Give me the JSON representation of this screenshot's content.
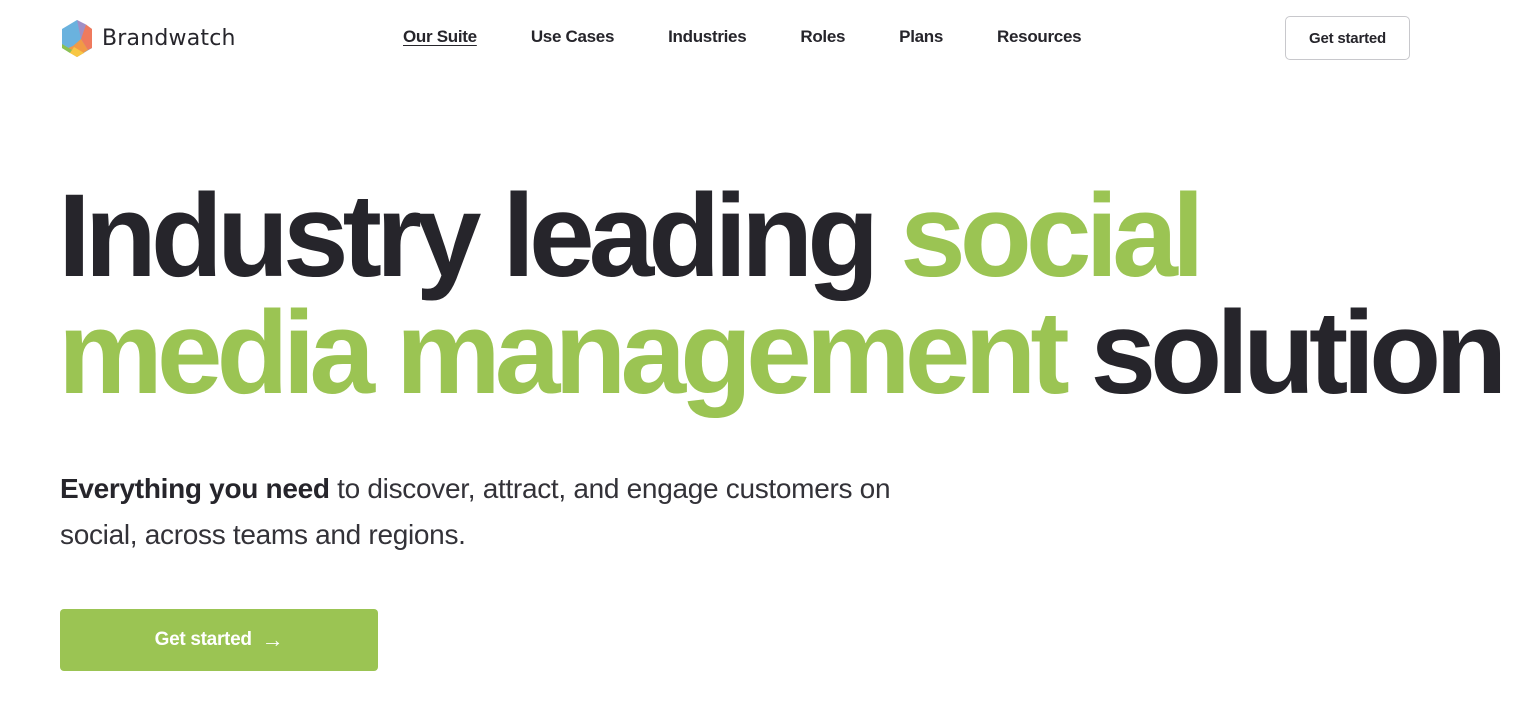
{
  "brand": {
    "name": "Brandwatch",
    "logo_colors": [
      "#6ab2de",
      "#a08fc6",
      "#ef7a5e",
      "#f29a45",
      "#f8c744",
      "#8cc152"
    ]
  },
  "nav": {
    "items": [
      {
        "label": "Our Suite",
        "active": true
      },
      {
        "label": "Use Cases",
        "active": false
      },
      {
        "label": "Industries",
        "active": false
      },
      {
        "label": "Roles",
        "active": false
      },
      {
        "label": "Plans",
        "active": false
      },
      {
        "label": "Resources",
        "active": false
      }
    ],
    "cta_label": "Get started"
  },
  "hero": {
    "headline": {
      "part1": "Industry leading ",
      "part2": "social",
      "part3": "media management",
      "part4": " solution"
    },
    "subheading": {
      "bold": "Everything you need",
      "rest": " to discover, attract, and engage customers on social, across teams and regions."
    },
    "cta_label": "Get started",
    "cta_icon": "arrow-right-icon"
  },
  "colors": {
    "accent": "#9bc453",
    "text": "#26252b"
  }
}
